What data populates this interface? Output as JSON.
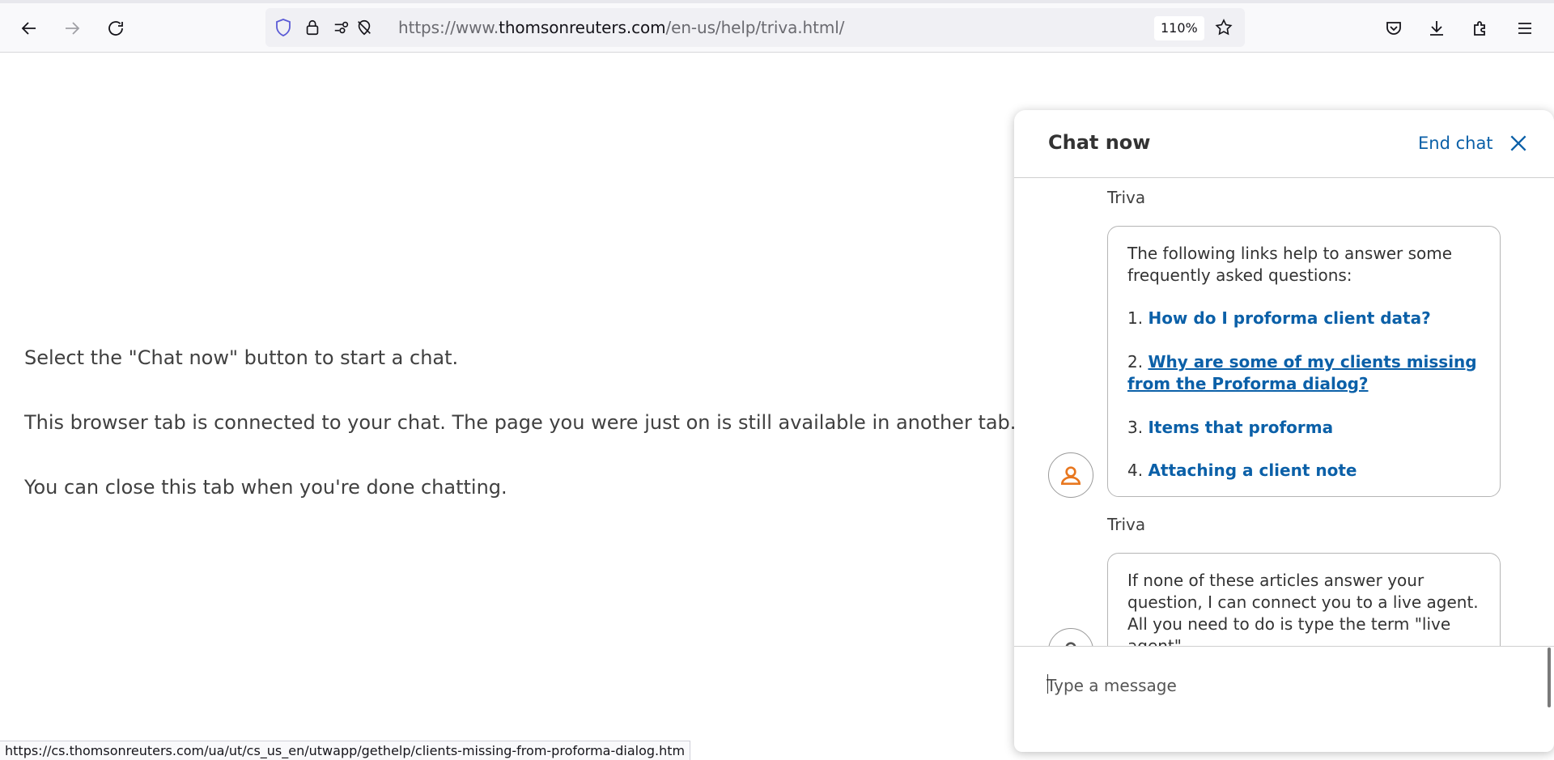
{
  "browser": {
    "url_prefix": "https://www.",
    "url_domain": "thomsonreuters.com",
    "url_path": "/en-us/help/triva.html/",
    "zoom": "110%",
    "status_url": "https://cs.thomsonreuters.com/ua/ut/cs_us_en/utwapp/gethelp/clients-missing-from-proforma-dialog.htm"
  },
  "page": {
    "line1": "Select the \"Chat now\" button to start a chat.",
    "line2": "This browser tab is connected to your chat. The page you were just on is still available in another tab.",
    "line3": "You can close this tab when you're done chatting."
  },
  "chat": {
    "title": "Chat now",
    "end_chat": "End chat",
    "input_placeholder": "Type a message",
    "messages": [
      {
        "sender": "Triva",
        "intro": "The following links help to answer some frequently asked questions:",
        "links": [
          {
            "num": "1.",
            "text": "How do I proforma client data?"
          },
          {
            "num": "2.",
            "text": "Why are some of my clients missing from the Proforma dialog?"
          },
          {
            "num": "3.",
            "text": "Items that proforma"
          },
          {
            "num": "4.",
            "text": "Attaching a client note"
          }
        ]
      },
      {
        "sender": "Triva",
        "text": "If none of these articles answer your question, I can connect you to a live agent. All you need to do is type the term \"live agent\"."
      }
    ]
  }
}
